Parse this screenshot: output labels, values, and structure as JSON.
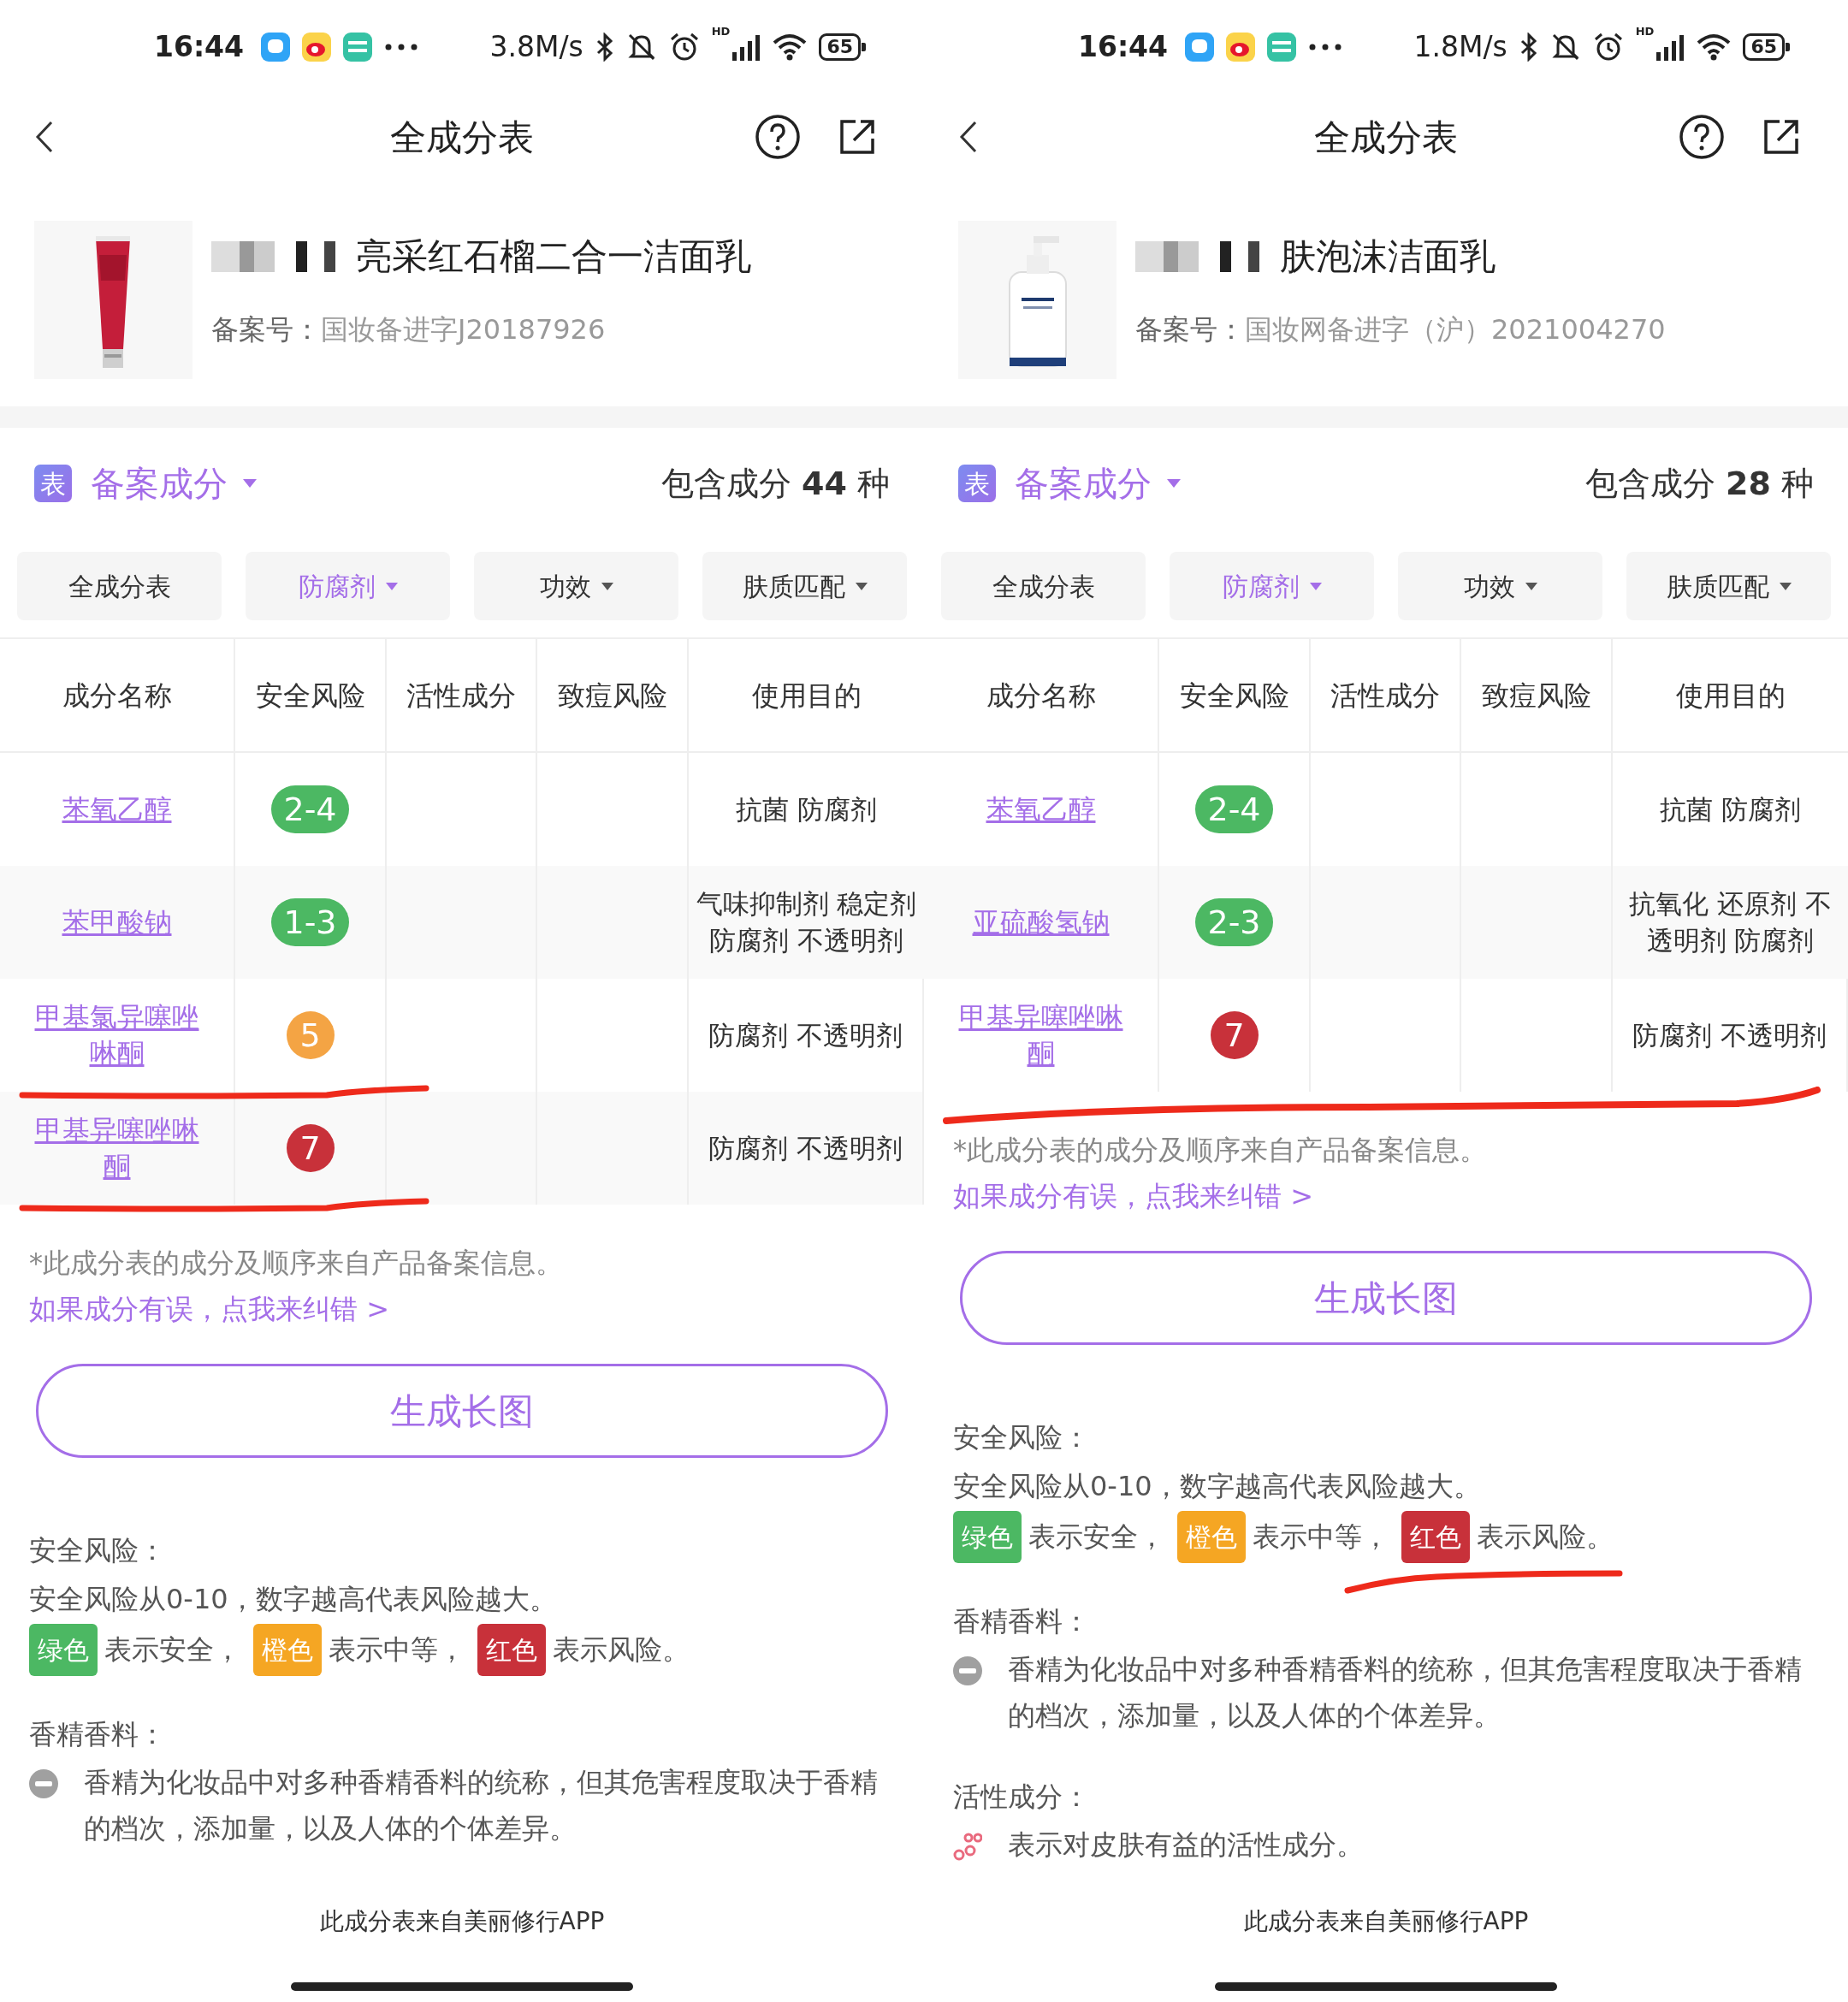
{
  "phones": [
    {
      "status_bar": {
        "time": "16:44",
        "speed": "3.8M/s",
        "network": "HD",
        "battery": "65"
      },
      "nav": {
        "title": "全成分表"
      },
      "product": {
        "name_redacted": true,
        "name": "亮采红石榴二合一洁面乳",
        "filing_label": "备案号：",
        "filing_number": "国妆备进字J20187926"
      },
      "section": {
        "icon_label": "表",
        "title": "备案成分",
        "count": "包含成分 **44** 种"
      },
      "filters": [
        {
          "label": "全成分表",
          "dropdown": false,
          "selected": false
        },
        {
          "label": "防腐剂",
          "dropdown": true,
          "selected": true
        },
        {
          "label": "功效",
          "dropdown": true,
          "selected": false
        },
        {
          "label": "肤质匹配",
          "dropdown": true,
          "selected": false
        }
      ],
      "table": {
        "columns": [
          "成分名称",
          "安全风险",
          "活性成分",
          "致痘风险",
          "使用目的"
        ],
        "rows": [
          {
            "name": "苯氧乙醇",
            "risk": "2-4",
            "color": "#4cb863",
            "purpose": "抗菌 防腐剂"
          },
          {
            "name": "苯甲酸钠",
            "risk": "1-3",
            "color": "#4cb863",
            "purpose": "气味抑制剂 稳定剂防腐剂 不透明剂"
          },
          {
            "name": "甲基氯异噻唑啉酮",
            "risk": "5",
            "color": "#f4a444",
            "purpose": "防腐剂 不透明剂",
            "underlined": true
          },
          {
            "name": "甲基异噻唑啉酮",
            "risk": "7",
            "color": "#c8313a",
            "purpose": "防腐剂 不透明剂",
            "underlined": true
          }
        ]
      },
      "note": "*此成分表的成分及顺序来自产品备案信息。",
      "correction_link": "如果成分有误，点我来纠错 >",
      "generate_button": "生成长图",
      "legend": [
        {
          "kind": "risk_scale",
          "heading": "安全风险：",
          "text": "安全风险从0-10，数字越高代表风险越大。",
          "scale": [
            {
              "tag": "绿色",
              "color": "#4cb863",
              "text": "表示安全，"
            },
            {
              "tag": "橙色",
              "color": "#f5a623",
              "text": "表示中等，"
            },
            {
              "tag": "红色",
              "color": "#c8313a",
              "text": "表示风险。"
            }
          ]
        },
        {
          "kind": "fragrance",
          "heading": "香精香料：",
          "text": "香精为化妆品中对多种香精香料的统称，但其危害程度取决于香精的档次，添加量，以及人体的个体差异。"
        }
      ],
      "footer": "此成分表来自美丽修行APP"
    },
    {
      "status_bar": {
        "time": "16:44",
        "speed": "1.8M/s",
        "network": "HD",
        "battery": "65"
      },
      "nav": {
        "title": "全成分表"
      },
      "product": {
        "name_redacted": true,
        "name": "肤泡沫洁面乳",
        "filing_label": "备案号：",
        "filing_number": "国妆网备进字（沪）2021004270"
      },
      "section": {
        "icon_label": "表",
        "title": "备案成分",
        "count": "包含成分 **28** 种"
      },
      "filters": [
        {
          "label": "全成分表",
          "dropdown": false,
          "selected": false
        },
        {
          "label": "防腐剂",
          "dropdown": true,
          "selected": true
        },
        {
          "label": "功效",
          "dropdown": true,
          "selected": false
        },
        {
          "label": "肤质匹配",
          "dropdown": true,
          "selected": false
        }
      ],
      "table": {
        "columns": [
          "成分名称",
          "安全风险",
          "活性成分",
          "致痘风险",
          "使用目的"
        ],
        "rows": [
          {
            "name": "苯氧乙醇",
            "risk": "2-4",
            "color": "#4cb863",
            "purpose": "抗菌 防腐剂"
          },
          {
            "name": "亚硫酸氢钠",
            "risk": "2-3",
            "color": "#4cb863",
            "purpose": "抗氧化 还原剂 不透明剂 防腐剂"
          },
          {
            "name": "甲基异噻唑啉酮",
            "risk": "7",
            "color": "#c8313a",
            "purpose": "防腐剂 不透明剂",
            "underlined": true,
            "underline_across": true
          }
        ]
      },
      "note": "*此成分表的成分及顺序来自产品备案信息。",
      "correction_link": "如果成分有误，点我来纠错 >",
      "generate_button": "生成长图",
      "legend": [
        {
          "kind": "risk_scale",
          "heading": "安全风险：",
          "text": "安全风险从0-10，数字越高代表风险越大。",
          "annotated": true,
          "scale": [
            {
              "tag": "绿色",
              "color": "#4cb863",
              "text": "表示安全，"
            },
            {
              "tag": "橙色",
              "color": "#f5a623",
              "text": "表示中等，"
            },
            {
              "tag": "红色",
              "color": "#c8313a",
              "text": "表示风险。"
            }
          ]
        },
        {
          "kind": "fragrance",
          "heading": "香精香料：",
          "text": "香精为化妆品中对多种香精香料的统称，但其危害程度取决于香精的档次，添加量，以及人体的个体差异。"
        },
        {
          "kind": "active",
          "heading": "活性成分：",
          "text": "表示对皮肤有益的活性成分。"
        }
      ],
      "footer": "此成分表来自美丽修行APP"
    }
  ]
}
